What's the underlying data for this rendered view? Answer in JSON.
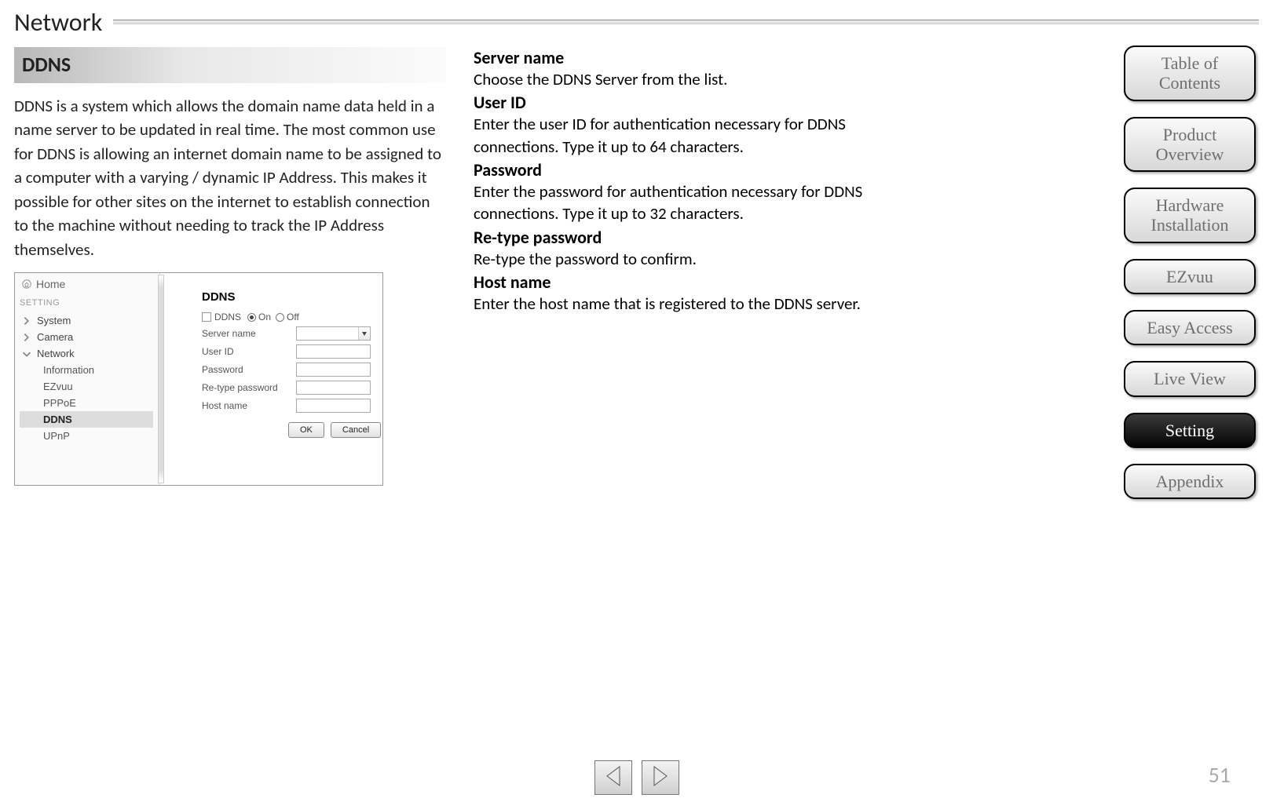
{
  "page": {
    "title": "Network",
    "number": "51"
  },
  "section": {
    "heading": "DDNS",
    "paragraph": "DDNS is a system which allows the domain name data held in a name server to be updated in real time. The most common use for DDNS is allowing an internet domain name to be assigned to a computer with a varying / dynamic IP Address. This makes it possible for other sites on the internet to establish connection to the machine without needing to track the IP Address themselves."
  },
  "screenshot": {
    "home": "Home",
    "setting_head": "SETTING",
    "nav": {
      "system": "System",
      "camera": "Camera",
      "network": "Network"
    },
    "subnav": {
      "information": "Information",
      "ezvuu": "EZvuu",
      "pppoe": "PPPoE",
      "ddns": "DDNS",
      "upnp": "UPnP"
    },
    "form": {
      "title": "DDNS",
      "enable_checkbox": "DDNS",
      "on": "On",
      "off": "Off",
      "server_name": "Server name",
      "user_id": "User ID",
      "password": "Password",
      "retype_password": "Re-type password",
      "host_name": "Host name",
      "ok": "OK",
      "cancel": "Cancel"
    }
  },
  "definitions": {
    "server_name": {
      "term": "Server name",
      "desc": "Choose the DDNS Server from the list."
    },
    "user_id": {
      "term": "User ID",
      "desc": "Enter the user ID for authentication necessary for DDNS connections. Type it up to 64 characters."
    },
    "password": {
      "term": "Password",
      "desc": "Enter the password for authentication necessary for DDNS connections. Type it up to 32 characters."
    },
    "retype_password": {
      "term": "Re-type password",
      "desc": "Re-type the password to confirm."
    },
    "host_name": {
      "term": "Host name",
      "desc": "Enter the host name that is registered to the DDNS server."
    }
  },
  "right_nav": {
    "toc": "Table of Contents",
    "product_overview": "Product Overview",
    "hardware_installation": "Hardware Installation",
    "ezvuu": "EZvuu",
    "easy_access": "Easy Access",
    "live_view": "Live View",
    "setting": "Setting",
    "appendix": "Appendix"
  }
}
